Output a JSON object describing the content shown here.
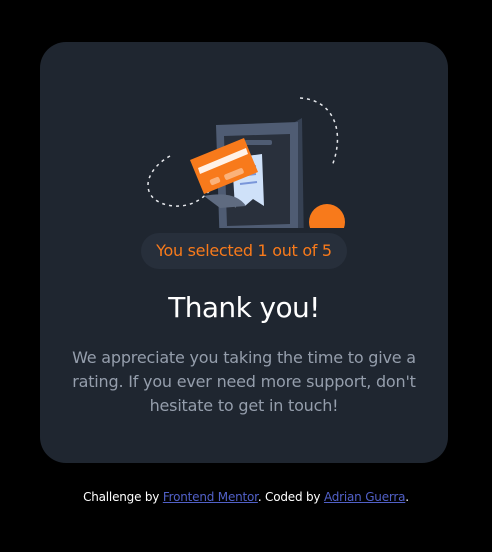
{
  "card": {
    "illustration_icon": "payment-receipt-illustration",
    "selected_badge": "You selected 1 out of 5",
    "title": "Thank you!",
    "message": "We appreciate you taking the time to give a rating. If you ever need more support, don't hesitate to get in touch!"
  },
  "attribution": {
    "prefix": "Challenge by ",
    "challenge_link": "Frontend Mentor",
    "middle": ". Coded by ",
    "author_link": "Adrian Guerra",
    "suffix": "."
  },
  "colors": {
    "page_background": "#000000",
    "card_background": "#1f2630",
    "accent_orange": "#f87a1b",
    "badge_background": "#272f3b",
    "body_text": "#959eac",
    "link": "#5160c7"
  }
}
